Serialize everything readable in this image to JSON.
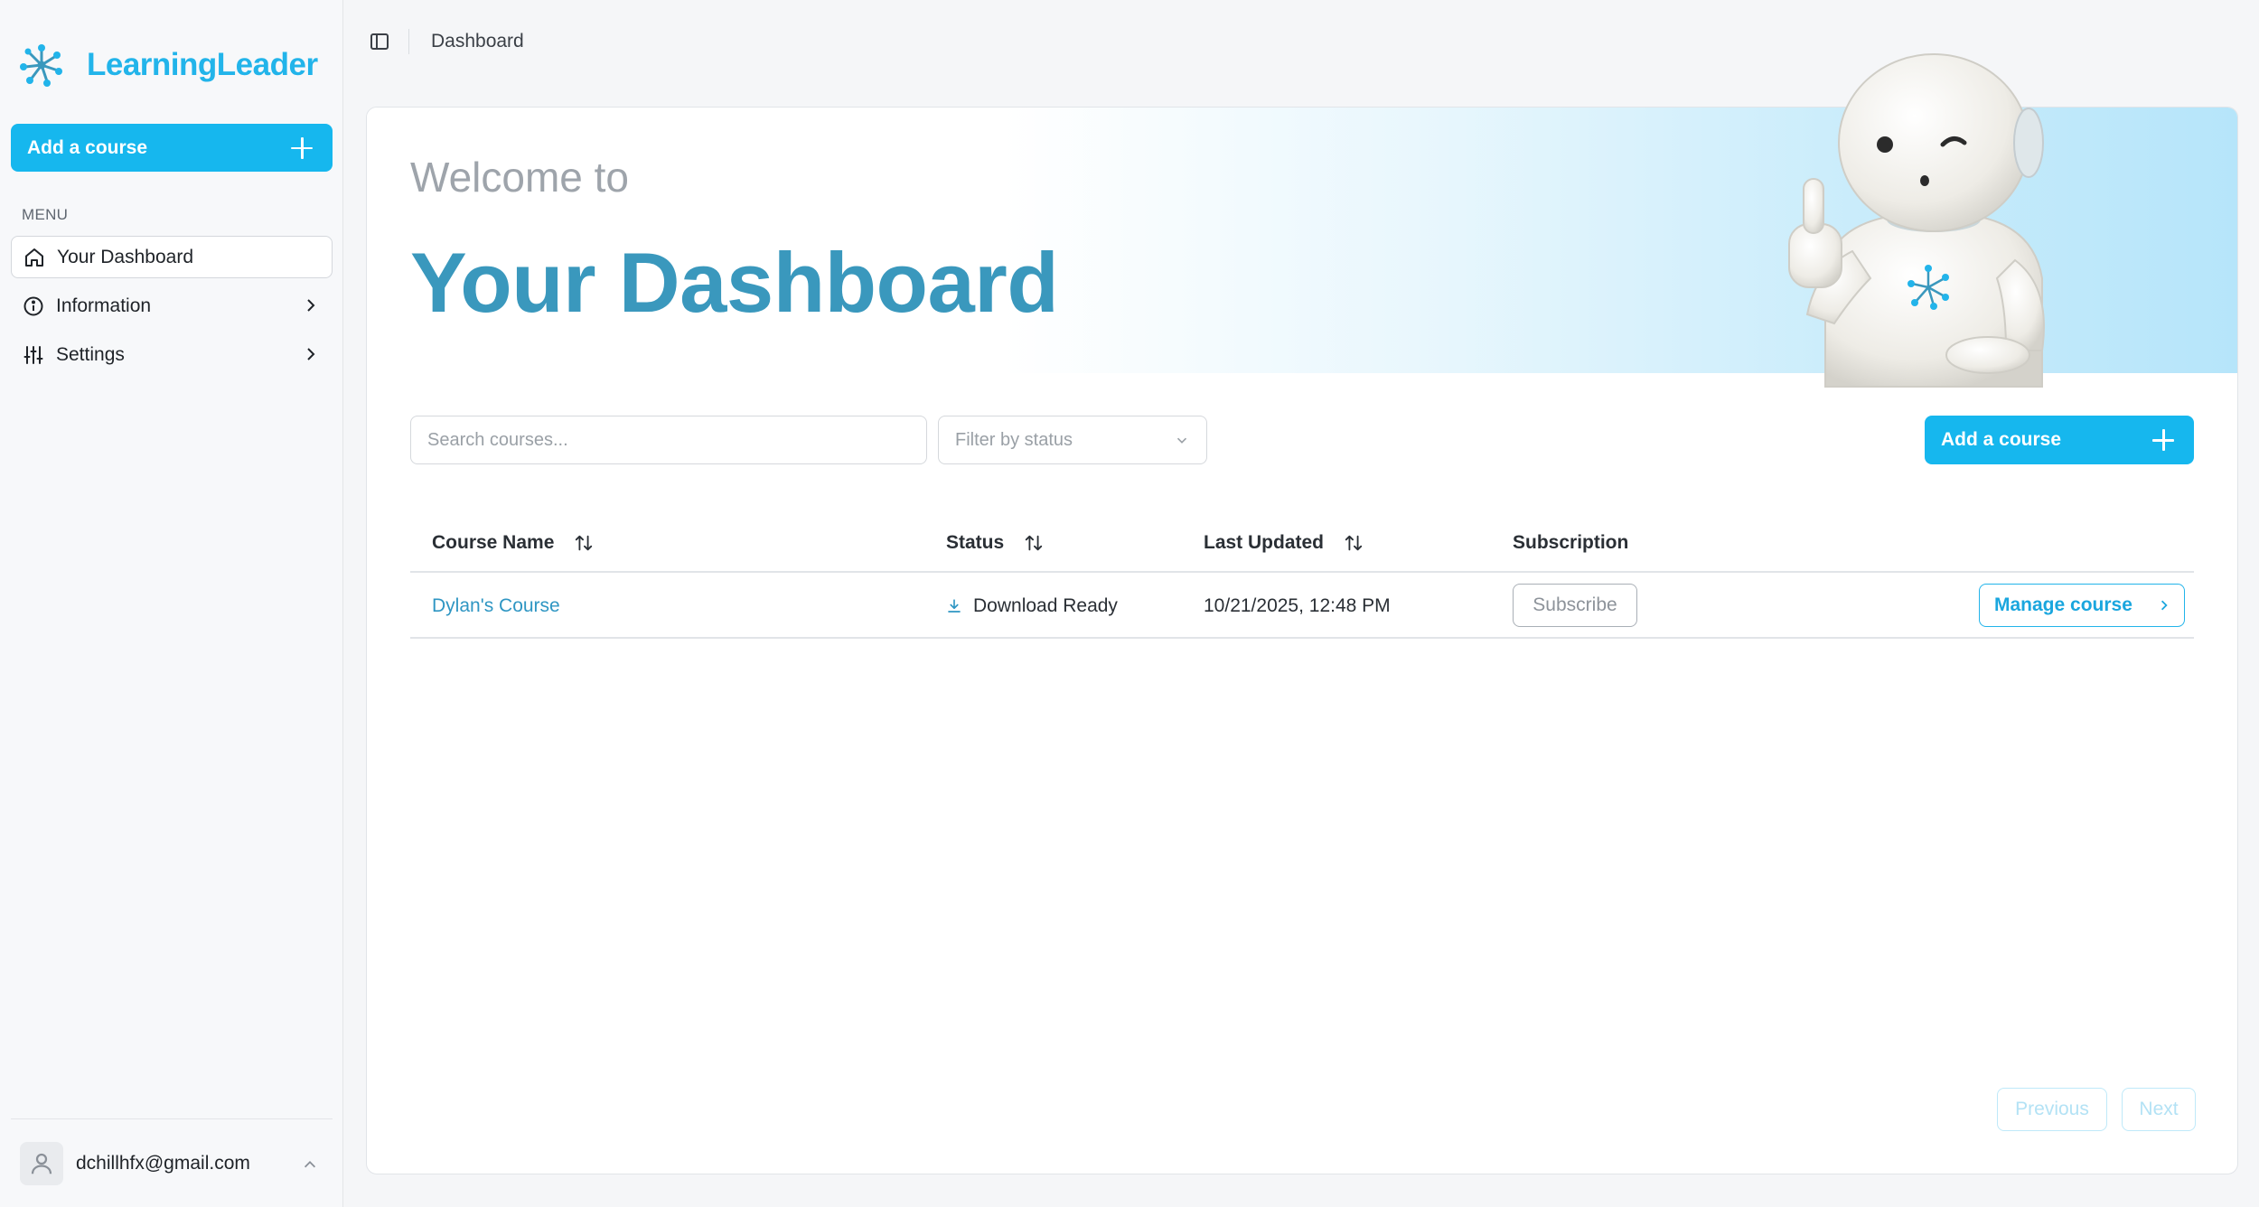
{
  "brand": {
    "name": "LearningLeader"
  },
  "sidebar": {
    "add_course_label": "Add a course",
    "menu_label": "MENU",
    "items": [
      {
        "label": "Your Dashboard",
        "icon": "home-icon",
        "active": true
      },
      {
        "label": "Information",
        "icon": "info-icon",
        "active": false
      },
      {
        "label": "Settings",
        "icon": "sliders-icon",
        "active": false
      }
    ],
    "user": {
      "email": "dchillhfx@gmail.com"
    }
  },
  "topbar": {
    "breadcrumb": "Dashboard"
  },
  "hero": {
    "welcome": "Welcome to",
    "title": "Your Dashboard"
  },
  "controls": {
    "search_placeholder": "Search courses...",
    "filter_placeholder": "Filter by status",
    "add_course_label": "Add a course"
  },
  "table": {
    "columns": [
      "Course Name",
      "Status",
      "Last Updated",
      "Subscription"
    ],
    "rows": [
      {
        "course_name": "Dylan's Course",
        "status": "Download Ready",
        "last_updated": "10/21/2025, 12:48 PM",
        "subscription_action": "Subscribe",
        "manage_action": "Manage course"
      }
    ]
  },
  "pagination": {
    "previous": "Previous",
    "next": "Next"
  },
  "colors": {
    "accent": "#16b7ee",
    "title": "#3a98bd",
    "link": "#2f96c3"
  }
}
